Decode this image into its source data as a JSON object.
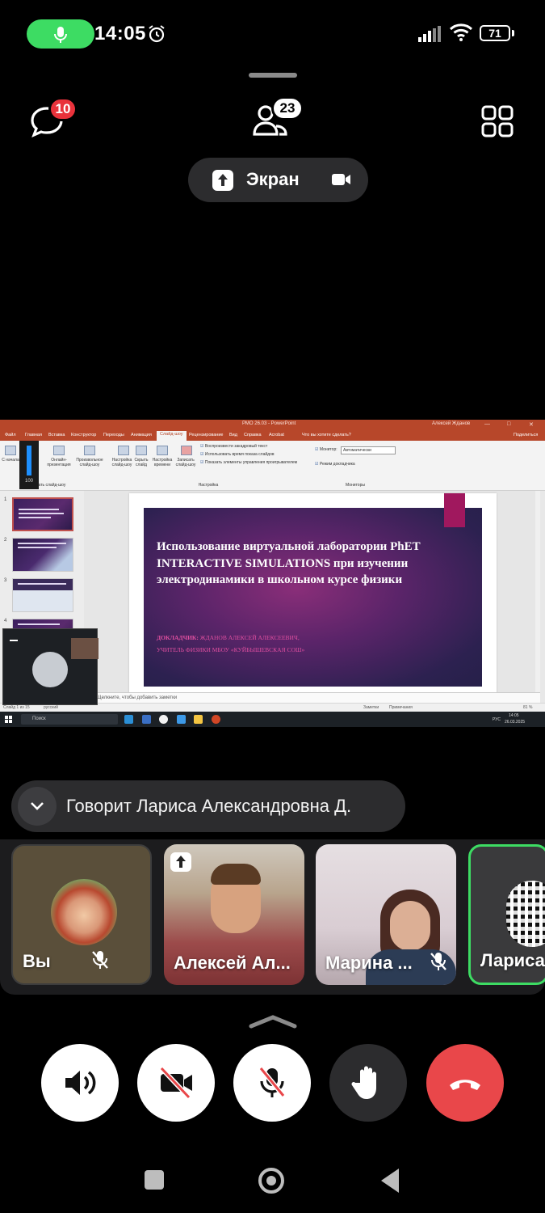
{
  "status": {
    "time": "14:05",
    "battery": "71"
  },
  "header": {
    "chat_badge": "10",
    "participants_badge": "23",
    "screen_label": "Экран"
  },
  "shared_screen": {
    "window_title": "РМО 26.03  -  PowerPoint",
    "user": "Алексей Жданов",
    "tabs": [
      "Файл",
      "Главная",
      "Вставка",
      "Конструктор",
      "Переходы",
      "Анимация",
      "Слайд-шоу",
      "Рецензирование",
      "Вид",
      "Справка",
      "Acrobat",
      "Что вы хотите сделать?"
    ],
    "share_label": "Поделиться",
    "ribbon": {
      "from_start": "С начала",
      "online": "Онлайн-презентация",
      "custom": "Произвольное слайд-шоу",
      "setup": "Настройка слайд-шоу",
      "hide": "Скрыть слайд",
      "timing": "Настройка времени",
      "record": "Записать слайд-шоу",
      "check1": "Воспроизвести закадровый текст",
      "check2": "Использовать время показа слайдов",
      "check3": "Показать элементы управления проигрывателем",
      "monitor_label": "Монитор:",
      "monitor_value": "Автоматически",
      "presenter": "Режим докладчика",
      "group_setup": "Настройка",
      "group_monitors": "Мониторы",
      "group_start": "Начать слайд-шоу"
    },
    "volume": "100",
    "slide": {
      "title": "Использование виртуальной лаборатории PhET INTERACTIVE SIMULATIONS при изучении электродинамики в школьном курсе физики",
      "speaker_label": "ДОКЛАДЧИК:",
      "speaker_name": "ЖДАНОВ АЛЕКСЕЙ АЛЕКСЕЕВИЧ,",
      "speaker_role": "УЧИТЕЛЬ ФИЗИКИ МБОУ «КУЙБЫШЕВСКАЯ СОШ»"
    },
    "thumb_numbers": [
      "1",
      "2",
      "3",
      "4"
    ],
    "notes": "Заметки к слайду",
    "notes_hint": "Щелкните, чтобы добавить заметки",
    "status_left": "Слайд 1 из 15",
    "status_lang": "русский",
    "status_notes": "Заметки",
    "status_comments": "Примечания",
    "zoom": "81 %",
    "taskbar_search": "Поиск",
    "tray_lang": "РУС",
    "tray_time": "14:05",
    "tray_date": "26.03.2025"
  },
  "speaker_banner": "Говорит Лариса Александровна Д.",
  "participants": [
    {
      "name": "Вы",
      "muted": true
    },
    {
      "name": "Алексей Ал...",
      "sharing": true
    },
    {
      "name": "Марина ...",
      "muted": true
    },
    {
      "name": "Лариса",
      "speaking": true
    }
  ]
}
